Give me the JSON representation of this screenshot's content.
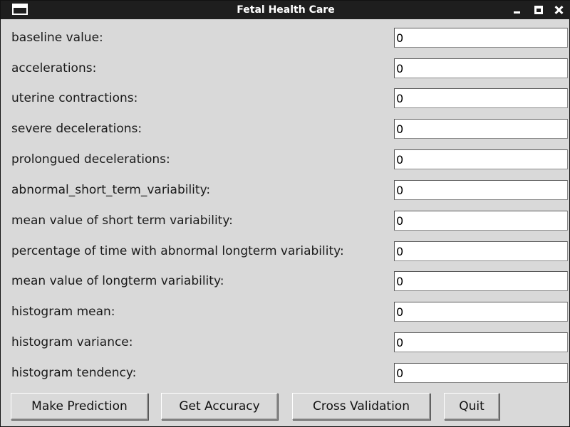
{
  "window": {
    "title": "Fetal Health Care"
  },
  "fields": [
    {
      "label": "baseline value:",
      "value": "0"
    },
    {
      "label": "accelerations:",
      "value": "0"
    },
    {
      "label": "uterine contractions:",
      "value": "0"
    },
    {
      "label": "severe decelerations:",
      "value": "0"
    },
    {
      "label": "prolongued decelerations:",
      "value": "0"
    },
    {
      "label": "abnormal_short_term_variability:",
      "value": "0"
    },
    {
      "label": "mean value of short term variability:",
      "value": "0"
    },
    {
      "label": "percentage of time with abnormal longterm variability:",
      "value": "0"
    },
    {
      "label": "mean value of longterm variability:",
      "value": "0"
    },
    {
      "label": "histogram mean:",
      "value": "0"
    },
    {
      "label": "histogram variance:",
      "value": "0"
    },
    {
      "label": "histogram tendency:",
      "value": "0"
    }
  ],
  "buttons": {
    "predict": "Make Prediction",
    "accuracy": "Get Accuracy",
    "cross_validation": "Cross Validation",
    "quit": "Quit"
  }
}
